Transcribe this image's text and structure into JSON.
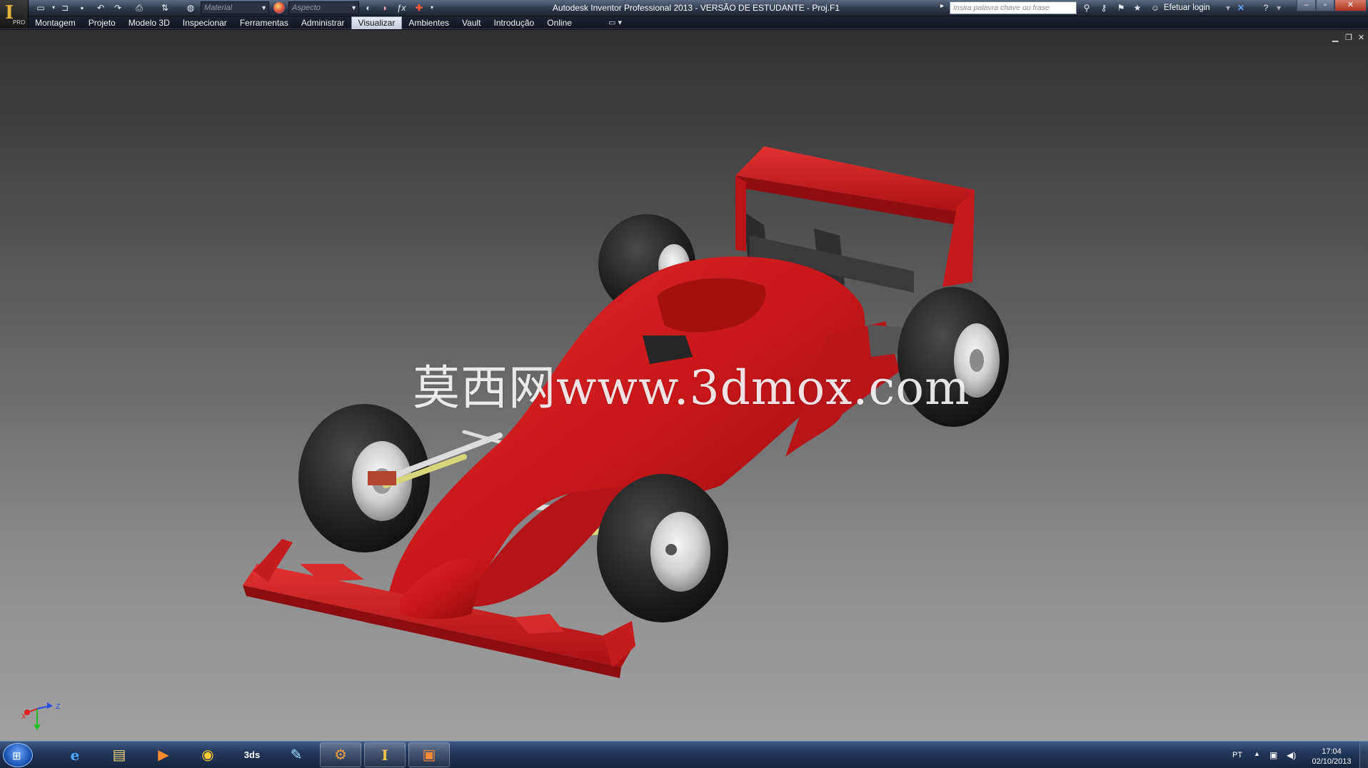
{
  "app": {
    "window_title": "Autodesk Inventor Professional 2013 - VERSÃO DE ESTUDANTE - Proj.F1",
    "badge": "PRO",
    "logo_letter": "I"
  },
  "quick_access": {
    "material_combo": "Material",
    "appearance_combo": "Aspecto",
    "function_symbol": "ƒx"
  },
  "search": {
    "placeholder": "Insira palavra chave ou frase"
  },
  "account": {
    "login_label": "Efetuar login"
  },
  "tabs": [
    {
      "label": "Montagem"
    },
    {
      "label": "Projeto"
    },
    {
      "label": "Modelo 3D"
    },
    {
      "label": "Inspecionar"
    },
    {
      "label": "Ferramentas"
    },
    {
      "label": "Administrar"
    },
    {
      "label": "Visualizar",
      "active": true
    },
    {
      "label": "Ambientes"
    },
    {
      "label": "Vault"
    },
    {
      "label": "Introdução"
    },
    {
      "label": "Online"
    }
  ],
  "viewport": {
    "watermark": "莫西网www.3dmox.com",
    "triad": {
      "x": "X",
      "y": "Y",
      "z": "Z"
    }
  },
  "taskbar": {
    "apps": [
      {
        "icon": "internet-explorer-icon",
        "glyph": "e"
      },
      {
        "icon": "file-explorer-icon",
        "glyph": "▤"
      },
      {
        "icon": "media-player-icon",
        "glyph": "▶"
      },
      {
        "icon": "chrome-icon",
        "glyph": "◉"
      },
      {
        "icon": "3ds-max-icon",
        "glyph": "3ds"
      },
      {
        "icon": "paint-icon",
        "glyph": "✎"
      },
      {
        "icon": "inventor-project-icon",
        "glyph": "⚙"
      },
      {
        "icon": "inventor-app-icon",
        "glyph": "I"
      },
      {
        "icon": "presentation-icon",
        "glyph": "▣"
      }
    ],
    "tray": {
      "language": "PT",
      "time": "17:04",
      "date": "02/10/2013"
    }
  },
  "colors": {
    "body_red": "#c8161a",
    "tire_black": "#1f1f1f",
    "rim_silver": "#d9d9d9",
    "ribbon_active": "#dfe5ee"
  }
}
